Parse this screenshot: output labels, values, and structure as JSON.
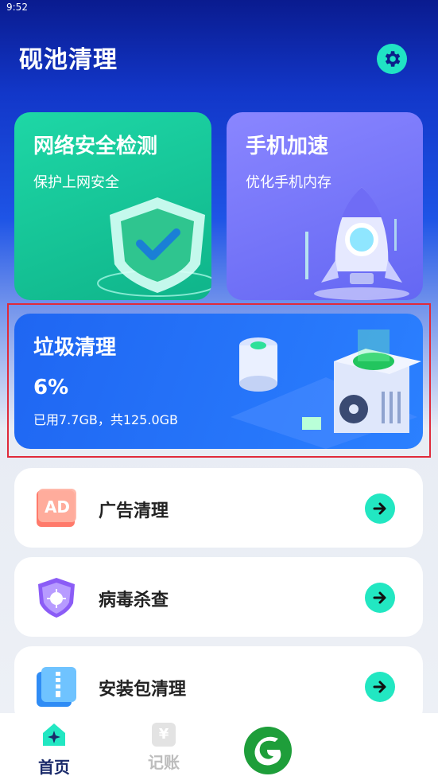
{
  "status_bar": {
    "time": "9:52"
  },
  "header": {
    "title": "砚池清理",
    "settings_icon": "gear-icon"
  },
  "cards": {
    "network": {
      "title": "网络安全检测",
      "subtitle": "保护上网安全"
    },
    "speed": {
      "title": "手机加速",
      "subtitle": "优化手机内存"
    },
    "junk": {
      "title": "垃圾清理",
      "percent": "6%",
      "usage": "已用7.7GB，共125.0GB"
    }
  },
  "list": [
    {
      "label": "广告清理",
      "icon": "ad-icon"
    },
    {
      "label": "病毒杀查",
      "icon": "virus-shield-icon"
    },
    {
      "label": "安装包清理",
      "icon": "zip-package-icon"
    }
  ],
  "tabbar": {
    "home": "首页",
    "book": "记账",
    "book_glyph": "¥"
  },
  "colors": {
    "accent": "#22e7c2",
    "junk_card": "#1f66f2",
    "network_card": "#1ed7a6",
    "speed_card": "#7a78fb",
    "highlight_frame": "#e02a3a"
  }
}
